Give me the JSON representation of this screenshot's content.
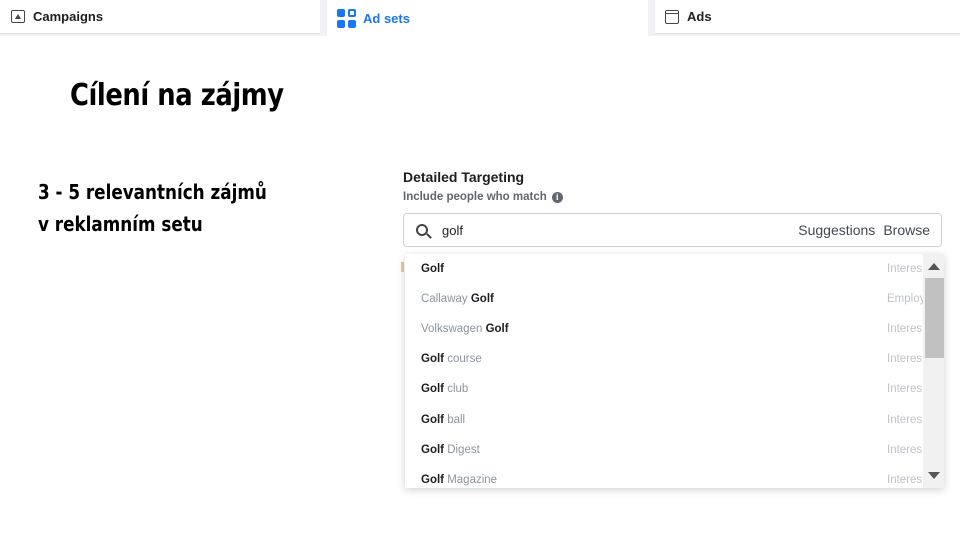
{
  "tabs": [
    {
      "label": "Campaigns",
      "icon": "campaign-flag-icon",
      "active": false
    },
    {
      "label": "Ad sets",
      "icon": "ad-sets-grid-icon",
      "active": true
    },
    {
      "label": "Ads",
      "icon": "ad-window-icon",
      "active": false
    }
  ],
  "slide": {
    "title": "Cílení na zájmy",
    "body_line1": "3 - 5 relevantních zájmů",
    "body_line2": "v reklamním setu"
  },
  "targeting": {
    "title": "Detailed Targeting",
    "subtitle": "Include people who match",
    "search_value": "golf",
    "suggestions_label": "Suggestions",
    "browse_label": "Browse"
  },
  "dropdown": {
    "items": [
      {
        "prefix": "",
        "match": "Golf",
        "suffix": "",
        "type": "Interes"
      },
      {
        "prefix": "Callaway ",
        "match": "Golf",
        "suffix": "",
        "type": "Employe"
      },
      {
        "prefix": "Volkswagen ",
        "match": "Golf",
        "suffix": "",
        "type": "Interes"
      },
      {
        "prefix": "",
        "match": "Golf",
        "suffix": " course",
        "type": "Interes"
      },
      {
        "prefix": "",
        "match": "Golf",
        "suffix": " club",
        "type": "Interes"
      },
      {
        "prefix": "",
        "match": "Golf",
        "suffix": " ball",
        "type": "Interes"
      },
      {
        "prefix": "",
        "match": "Golf",
        "suffix": " Digest",
        "type": "Interes"
      },
      {
        "prefix": "",
        "match": "Golf",
        "suffix": " Magazine",
        "type": "Interes"
      }
    ]
  },
  "colors": {
    "accent": "#1877f2",
    "text": "#1c1e21",
    "muted": "#8d949e"
  }
}
